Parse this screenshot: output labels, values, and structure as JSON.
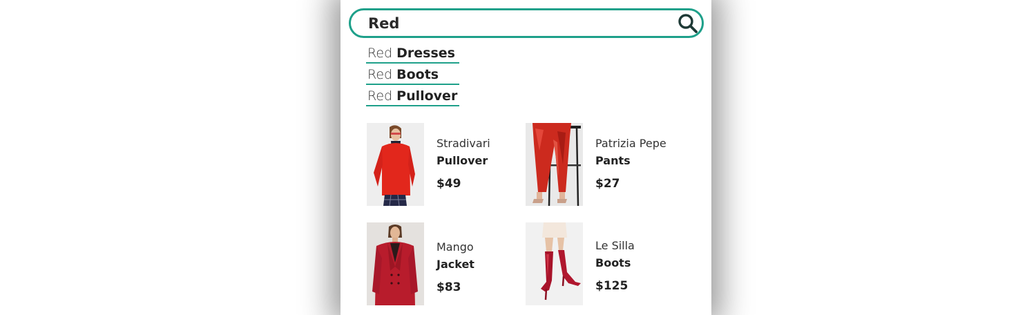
{
  "search": {
    "value": "Red",
    "button_icon": "search-icon",
    "accent_color": "#1ea08a"
  },
  "suggestions": [
    {
      "prefix": "Red",
      "term": "Dresses"
    },
    {
      "prefix": "Red",
      "term": "Boots"
    },
    {
      "prefix": "Red",
      "term": "Pullover"
    }
  ],
  "products": [
    {
      "brand": "Stradivari",
      "type": "Pullover",
      "price": "$49",
      "image": "red-pullover-photo"
    },
    {
      "brand": "Patrizia Pepe",
      "type": "Pants",
      "price": "$27",
      "image": "red-sequin-pants-photo"
    },
    {
      "brand": "Mango",
      "type": "Jacket",
      "price": "$83",
      "image": "red-jacket-photo"
    },
    {
      "brand": "Le Silla",
      "type": "Boots",
      "price": "$125",
      "image": "red-boots-photo"
    }
  ]
}
